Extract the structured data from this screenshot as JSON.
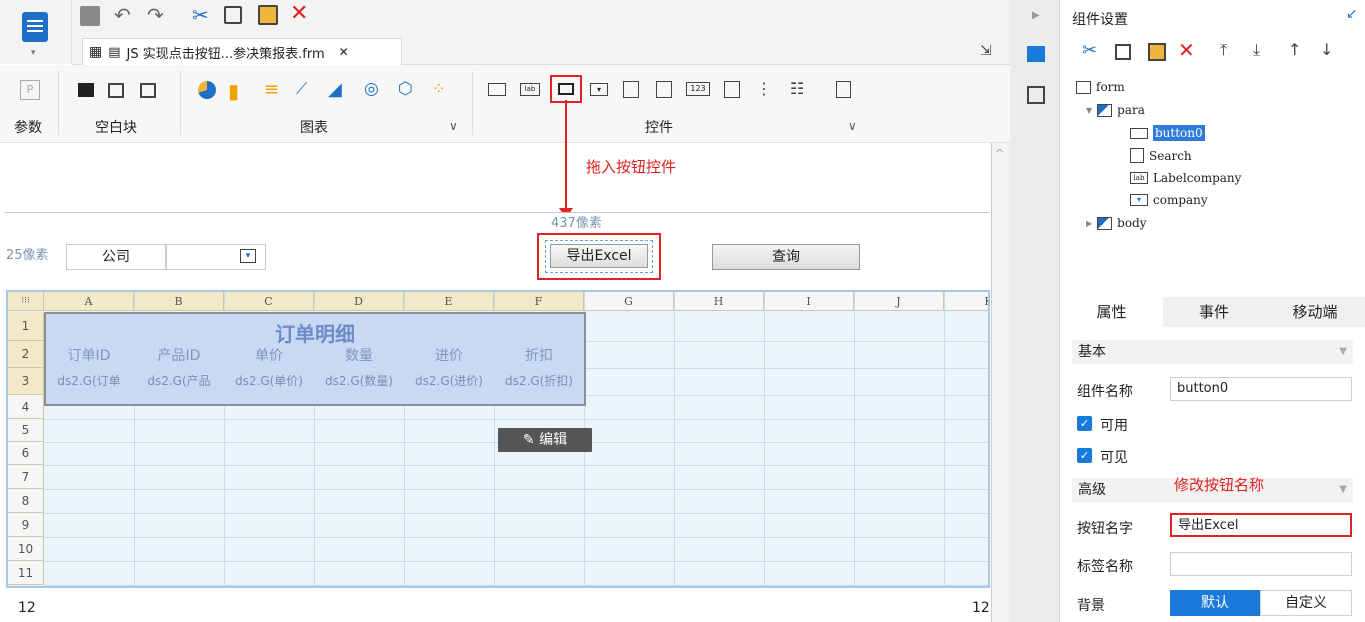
{
  "toolbar": {
    "tab_label": "JS 实现点击按钮...参决策报表.frm"
  },
  "ribbon": {
    "param_label": "参数",
    "blank_label": "空白块",
    "chart_label": "图表",
    "control_label": "控件"
  },
  "annotations": {
    "drag_button": "拖入按钮控件",
    "rename_button": "修改按钮名称"
  },
  "canvas": {
    "width_label": "437像素",
    "height_label": "25像素",
    "company_label": "公司",
    "export_button": "导出Excel",
    "query_button": "查询",
    "edit_button": "编辑",
    "footer_left": "12",
    "footer_right": "12"
  },
  "grid": {
    "columns": [
      "A",
      "B",
      "C",
      "D",
      "E",
      "F",
      "G",
      "H",
      "I",
      "J",
      "K"
    ],
    "rows": [
      "1",
      "2",
      "3",
      "4",
      "5",
      "6",
      "7",
      "8",
      "9",
      "10",
      "11"
    ],
    "title": "订单明细",
    "headers": [
      "订单ID",
      "产品ID",
      "单价",
      "数量",
      "进价",
      "折扣"
    ],
    "formulas": [
      "ds2.G(订单",
      "ds2.G(产品",
      "ds2.G(单价)",
      "ds2.G(数量)",
      "ds2.G(进价)",
      "ds2.G(折扣)"
    ]
  },
  "panel": {
    "title": "组件设置",
    "tree": {
      "form": "form",
      "para": "para",
      "button0": "button0",
      "search": "Search",
      "labelcompany": "Labelcompany",
      "company": "company",
      "body": "body"
    },
    "tabs": [
      "属性",
      "事件",
      "移动端"
    ],
    "basic_section": "基本",
    "component_name_label": "组件名称",
    "component_name_value": "button0",
    "enabled_label": "可用",
    "visible_label": "可见",
    "advanced_section": "高级",
    "button_name_label": "按钮名字",
    "button_name_value": "导出Excel",
    "tag_name_label": "标签名称",
    "tag_name_value": "",
    "background_label": "背景",
    "bg_default": "默认",
    "bg_custom": "自定义"
  },
  "colors": {
    "accent": "#1a7ad9",
    "highlight_red": "#e02222",
    "selection_blue": "#2f7bd9"
  }
}
